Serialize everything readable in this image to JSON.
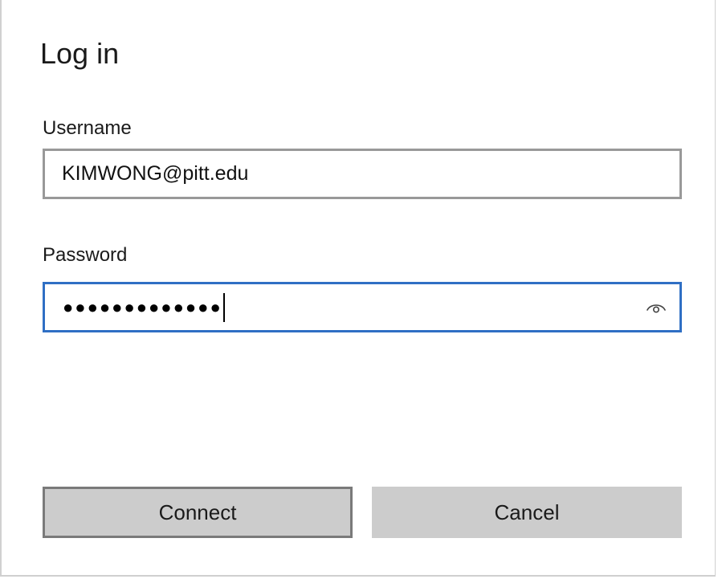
{
  "dialog": {
    "title": "Log in",
    "username": {
      "label": "Username",
      "value": "KIMWONG@pitt.edu"
    },
    "password": {
      "label": "Password",
      "masked_value": "●●●●●●●●●●●●●",
      "reveal_icon": "eye-icon"
    },
    "buttons": {
      "connect_label": "Connect",
      "cancel_label": "Cancel"
    }
  },
  "colors": {
    "focus_border": "#2f6fc4",
    "input_border": "#999999",
    "button_bg": "#cccccc",
    "default_button_border": "#7a7a7a"
  }
}
